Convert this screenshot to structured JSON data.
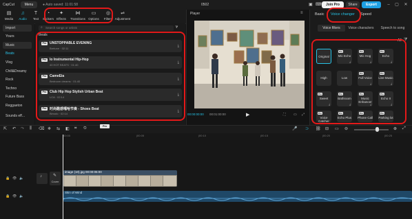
{
  "titlebar": {
    "app_name": "CapCut",
    "menu_label": "Menu",
    "save_status": "Auto saved: 11:01:58",
    "project_title": "0502",
    "join_pro_label": "Join Pro",
    "share_label": "Share",
    "export_label": "Export"
  },
  "toolbar": {
    "tools": [
      {
        "label": "Media",
        "icon": "media-icon"
      },
      {
        "label": "Audio",
        "icon": "audio-icon"
      },
      {
        "label": "Text",
        "icon": "text-icon"
      },
      {
        "label": "Stickers",
        "icon": "sticker-icon"
      },
      {
        "label": "Effects",
        "icon": "effects-icon"
      },
      {
        "label": "Transitions",
        "icon": "transitions-icon"
      },
      {
        "label": "Options",
        "icon": "options-icon"
      },
      {
        "label": "Filters",
        "icon": "filters-icon"
      },
      {
        "label": "Adjustment",
        "icon": "adjustment-icon"
      }
    ]
  },
  "leftnav": {
    "items": [
      "Import",
      "Yours",
      "Music",
      "Beats",
      "Vlog",
      "Chill&Dreamy",
      "Rock",
      "Techno",
      "Future Bass",
      "Reggaeton",
      "Sounds eff..."
    ]
  },
  "library": {
    "search_placeholder": "Search songs or artists",
    "section_title": "Beats",
    "tracks": [
      {
        "title": "UNSTOPPABLE EVENING",
        "subtitle": "Bretune · 02:11"
      },
      {
        "title": "lo Instrumental Hip-Hop",
        "subtitle": "40 HOT BEATS · 01:40"
      },
      {
        "title": "CameEia",
        "subtitle": "Bedroom dreams · 01:40"
      },
      {
        "title": "Club Hip Hop Stylish Urban Beat",
        "subtitle": "LCA · 02:14"
      },
      {
        "title": "时尚酷感嘻哈节奏 - Shoes Beat",
        "subtitle": "Bimoto · 02:14"
      }
    ]
  },
  "player": {
    "label": "Player",
    "time_current": "00:00:00:00",
    "time_total": "00:01:00:00"
  },
  "right": {
    "tabs": [
      "Basic",
      "Voice changer",
      "Speed"
    ],
    "subtabs": [
      "Voice filters",
      "Voice characters",
      "Speech to song"
    ],
    "filter_all": "All",
    "voices": [
      {
        "label": "Original",
        "pro": false
      },
      {
        "label": "Mic Echo",
        "pro": true
      },
      {
        "label": "Mic Hog",
        "pro": true
      },
      {
        "label": "Echo",
        "pro": true
      },
      {
        "label": "High",
        "pro": false
      },
      {
        "label": "Low",
        "pro": false
      },
      {
        "label": "Full Voice",
        "pro": true
      },
      {
        "label": "Live Music",
        "pro": true
      },
      {
        "label": "Sweet",
        "pro": true
      },
      {
        "label": "Bathroom",
        "pro": true
      },
      {
        "label": "Music Enhancer",
        "pro": true
      },
      {
        "label": "Echo II",
        "pro": true
      },
      {
        "label": "Voice Catcher",
        "pro": true
      },
      {
        "label": "Echo Plus",
        "pro": true
      },
      {
        "label": "Phone Call",
        "pro": true
      },
      {
        "label": "Parking lot",
        "pro": true
      }
    ]
  },
  "timeline": {
    "ruler": [
      "00:00",
      "|00:05",
      "|00:10",
      "|00:15",
      "|00:20",
      "|00:25"
    ],
    "cover_label": "Cover",
    "video_clip": "image (10).jpg  00:00:05:00",
    "audio_clip": "Skin of Wind"
  }
}
